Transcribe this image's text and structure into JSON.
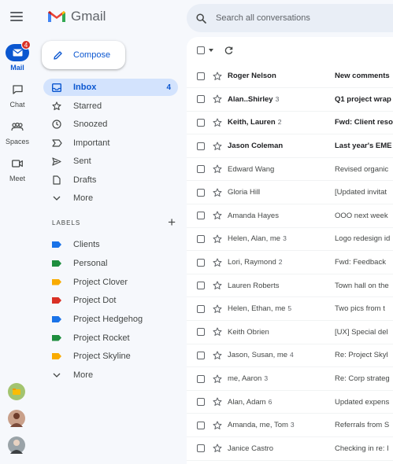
{
  "app": {
    "name": "Gmail"
  },
  "rail": {
    "items": [
      {
        "label": "Mail",
        "badge": "4"
      },
      {
        "label": "Chat"
      },
      {
        "label": "Spaces"
      },
      {
        "label": "Meet"
      }
    ]
  },
  "compose": {
    "label": "Compose"
  },
  "nav": {
    "items": [
      {
        "label": "Inbox",
        "count": "4",
        "icon": "inbox-icon"
      },
      {
        "label": "Starred",
        "icon": "star-icon"
      },
      {
        "label": "Snoozed",
        "icon": "clock-icon"
      },
      {
        "label": "Important",
        "icon": "important-icon"
      },
      {
        "label": "Sent",
        "icon": "send-icon"
      },
      {
        "label": "Drafts",
        "icon": "draft-icon"
      },
      {
        "label": "More",
        "icon": "chevron-down-icon"
      }
    ]
  },
  "labels": {
    "heading": "LABELS",
    "items": [
      {
        "label": "Clients",
        "color": "#1a73e8"
      },
      {
        "label": "Personal",
        "color": "#1e8e3e"
      },
      {
        "label": "Project Clover",
        "color": "#f9ab00"
      },
      {
        "label": "Project Dot",
        "color": "#d93025"
      },
      {
        "label": "Project Hedgehog",
        "color": "#1a73e8"
      },
      {
        "label": "Project Rocket",
        "color": "#1e8e3e"
      },
      {
        "label": "Project Skyline",
        "color": "#f9ab00"
      }
    ],
    "more": "More"
  },
  "search": {
    "placeholder": "Search all conversations"
  },
  "emails": [
    {
      "sender": "Roger Nelson",
      "count": "",
      "subject": "New comments",
      "unread": true
    },
    {
      "sender": "Alan..Shirley",
      "count": "3",
      "subject": "Q1 project wrap",
      "unread": true
    },
    {
      "sender": "Keith, Lauren",
      "count": "2",
      "subject": "Fwd: Client reso",
      "unread": true
    },
    {
      "sender": "Jason Coleman",
      "count": "",
      "subject": "Last year's EME",
      "unread": true
    },
    {
      "sender": "Edward Wang",
      "count": "",
      "subject": "Revised organic",
      "unread": false
    },
    {
      "sender": "Gloria Hill",
      "count": "",
      "subject": "[Updated invitat",
      "unread": false
    },
    {
      "sender": "Amanda Hayes",
      "count": "",
      "subject": "OOO next week",
      "unread": false
    },
    {
      "sender": "Helen, Alan, me",
      "count": "3",
      "subject": "Logo redesign id",
      "unread": false
    },
    {
      "sender": "Lori, Raymond",
      "count": "2",
      "subject": "Fwd: Feedback",
      "unread": false
    },
    {
      "sender": "Lauren Roberts",
      "count": "",
      "subject": "Town hall on the",
      "unread": false
    },
    {
      "sender": "Helen, Ethan, me",
      "count": "5",
      "subject": "Two pics from t",
      "unread": false
    },
    {
      "sender": "Keith Obrien",
      "count": "",
      "subject": "[UX] Special del",
      "unread": false
    },
    {
      "sender": "Jason, Susan, me",
      "count": "4",
      "subject": "Re: Project Skyl",
      "unread": false
    },
    {
      "sender": "me, Aaron",
      "count": "3",
      "subject": "Re: Corp strateg",
      "unread": false
    },
    {
      "sender": "Alan, Adam",
      "count": "6",
      "subject": "Updated expens",
      "unread": false
    },
    {
      "sender": "Amanda, me, Tom",
      "count": "3",
      "subject": "Referrals from S",
      "unread": false
    },
    {
      "sender": "Janice Castro",
      "count": "",
      "subject": "Checking in re: I",
      "unread": false
    }
  ]
}
